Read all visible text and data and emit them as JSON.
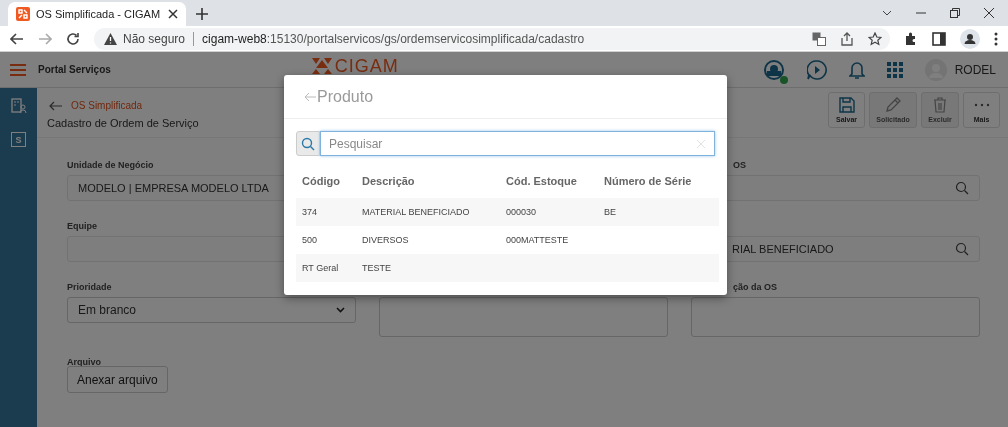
{
  "browser": {
    "tab_title": "OS Simplificada - CIGAM",
    "url_warning": "Não seguro",
    "url_host": "cigam-web8",
    "url_path": ":15130/portalservicos/gs/ordemservicosimplificada/cadastro"
  },
  "header": {
    "title": "Portal Serviços",
    "logo": "CIGAM",
    "user": "RODEL",
    "online": true
  },
  "sidebar": {
    "items": [
      {
        "kind": "icon"
      },
      {
        "kind": "letter",
        "text": "S"
      }
    ]
  },
  "breadcrumb": "OS Simplificada",
  "page_title": "Cadastro de Ordem de Serviço",
  "actions": [
    {
      "label": "Salvar",
      "kind": "save",
      "disabled": false
    },
    {
      "label": "Solicitado",
      "kind": "edit",
      "disabled": true
    },
    {
      "label": "Excluir",
      "kind": "delete",
      "disabled": true
    },
    {
      "label": "Mais",
      "kind": "more",
      "disabled": false
    }
  ],
  "form": {
    "fields": [
      {
        "label": "Unidade de Negócio",
        "kind": "text",
        "value": "MODELO | EMPRESA MODELO LTDA"
      },
      {
        "label": "OS",
        "kind": "lookup"
      },
      {
        "label": "Equipe",
        "kind": "text"
      },
      {
        "kind": "lookup",
        "value": "RIAL BENEFICIADO"
      },
      {
        "label": "Prioridade",
        "kind": "select",
        "value": "Em branco"
      },
      {
        "kind": "textarea"
      },
      {
        "label": "ção da OS",
        "kind": "textarea"
      },
      {
        "label": "Arquivo",
        "kind": "file",
        "value": "Anexar arquivo"
      }
    ]
  },
  "dialog": {
    "title": "Produto",
    "search": {
      "placeholder": "Pesquisar"
    },
    "table": {
      "columns": [
        "Código",
        "Descrição",
        "Cód. Estoque",
        "Número de Série"
      ],
      "rows": [
        [
          "374",
          "MATERIAL BENEFICIADO",
          "000030",
          "BE"
        ],
        [
          "500",
          "DIVERSOS",
          "000MATTESTE",
          ""
        ],
        [
          "RT Geral",
          "TESTE",
          "",
          ""
        ]
      ]
    }
  }
}
